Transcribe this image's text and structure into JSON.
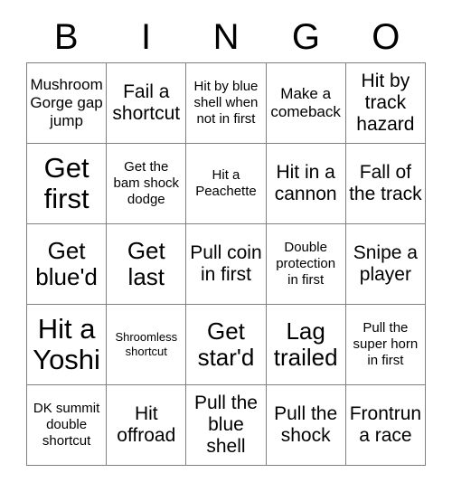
{
  "card": {
    "title": "BINGO",
    "headers": [
      "B",
      "I",
      "N",
      "G",
      "O"
    ],
    "columns": 5,
    "rows": 5,
    "border_color": "#808080",
    "background_color": "#ffffff",
    "text_color": "#000000",
    "cells": [
      [
        {
          "text": "Mushroom Gorge gap jump",
          "size": "fs-sm",
          "marked": false
        },
        {
          "text": "Fail a shortcut",
          "size": "fs-md",
          "marked": false
        },
        {
          "text": "Hit by blue shell when not in first",
          "size": "fs-xs",
          "marked": false
        },
        {
          "text": "Make a comeback",
          "size": "fs-sm",
          "marked": false
        },
        {
          "text": "Hit by track hazard",
          "size": "fs-md",
          "marked": false
        }
      ],
      [
        {
          "text": "Get first",
          "size": "fs-xl",
          "marked": false
        },
        {
          "text": "Get the bam shock dodge",
          "size": "fs-xs",
          "marked": false
        },
        {
          "text": "Hit a Peachette",
          "size": "fs-xs",
          "marked": false
        },
        {
          "text": "Hit in a cannon",
          "size": "fs-md",
          "marked": false
        },
        {
          "text": "Fall of the track",
          "size": "fs-md",
          "marked": false
        }
      ],
      [
        {
          "text": "Get blue'd",
          "size": "fs-lg",
          "marked": false
        },
        {
          "text": "Get last",
          "size": "fs-lg",
          "marked": false
        },
        {
          "text": "Pull coin in first",
          "size": "fs-md",
          "marked": false
        },
        {
          "text": "Double protection in first",
          "size": "fs-xs",
          "marked": false
        },
        {
          "text": "Snipe a player",
          "size": "fs-md",
          "marked": false
        }
      ],
      [
        {
          "text": "Hit a Yoshi",
          "size": "fs-xl",
          "marked": false
        },
        {
          "text": "Shroomless shortcut",
          "size": "fs-xxs",
          "marked": false
        },
        {
          "text": "Get star'd",
          "size": "fs-lg",
          "marked": false
        },
        {
          "text": "Lag trailed",
          "size": "fs-lg",
          "marked": false
        },
        {
          "text": "Pull the super horn in first",
          "size": "fs-xs",
          "marked": false
        }
      ],
      [
        {
          "text": "DK summit double shortcut",
          "size": "fs-xs",
          "marked": false
        },
        {
          "text": "Hit offroad",
          "size": "fs-md",
          "marked": false
        },
        {
          "text": "Pull the blue shell",
          "size": "fs-md",
          "marked": false
        },
        {
          "text": "Pull the shock",
          "size": "fs-md",
          "marked": false
        },
        {
          "text": "Frontrun a race",
          "size": "fs-md",
          "marked": false
        }
      ]
    ]
  }
}
